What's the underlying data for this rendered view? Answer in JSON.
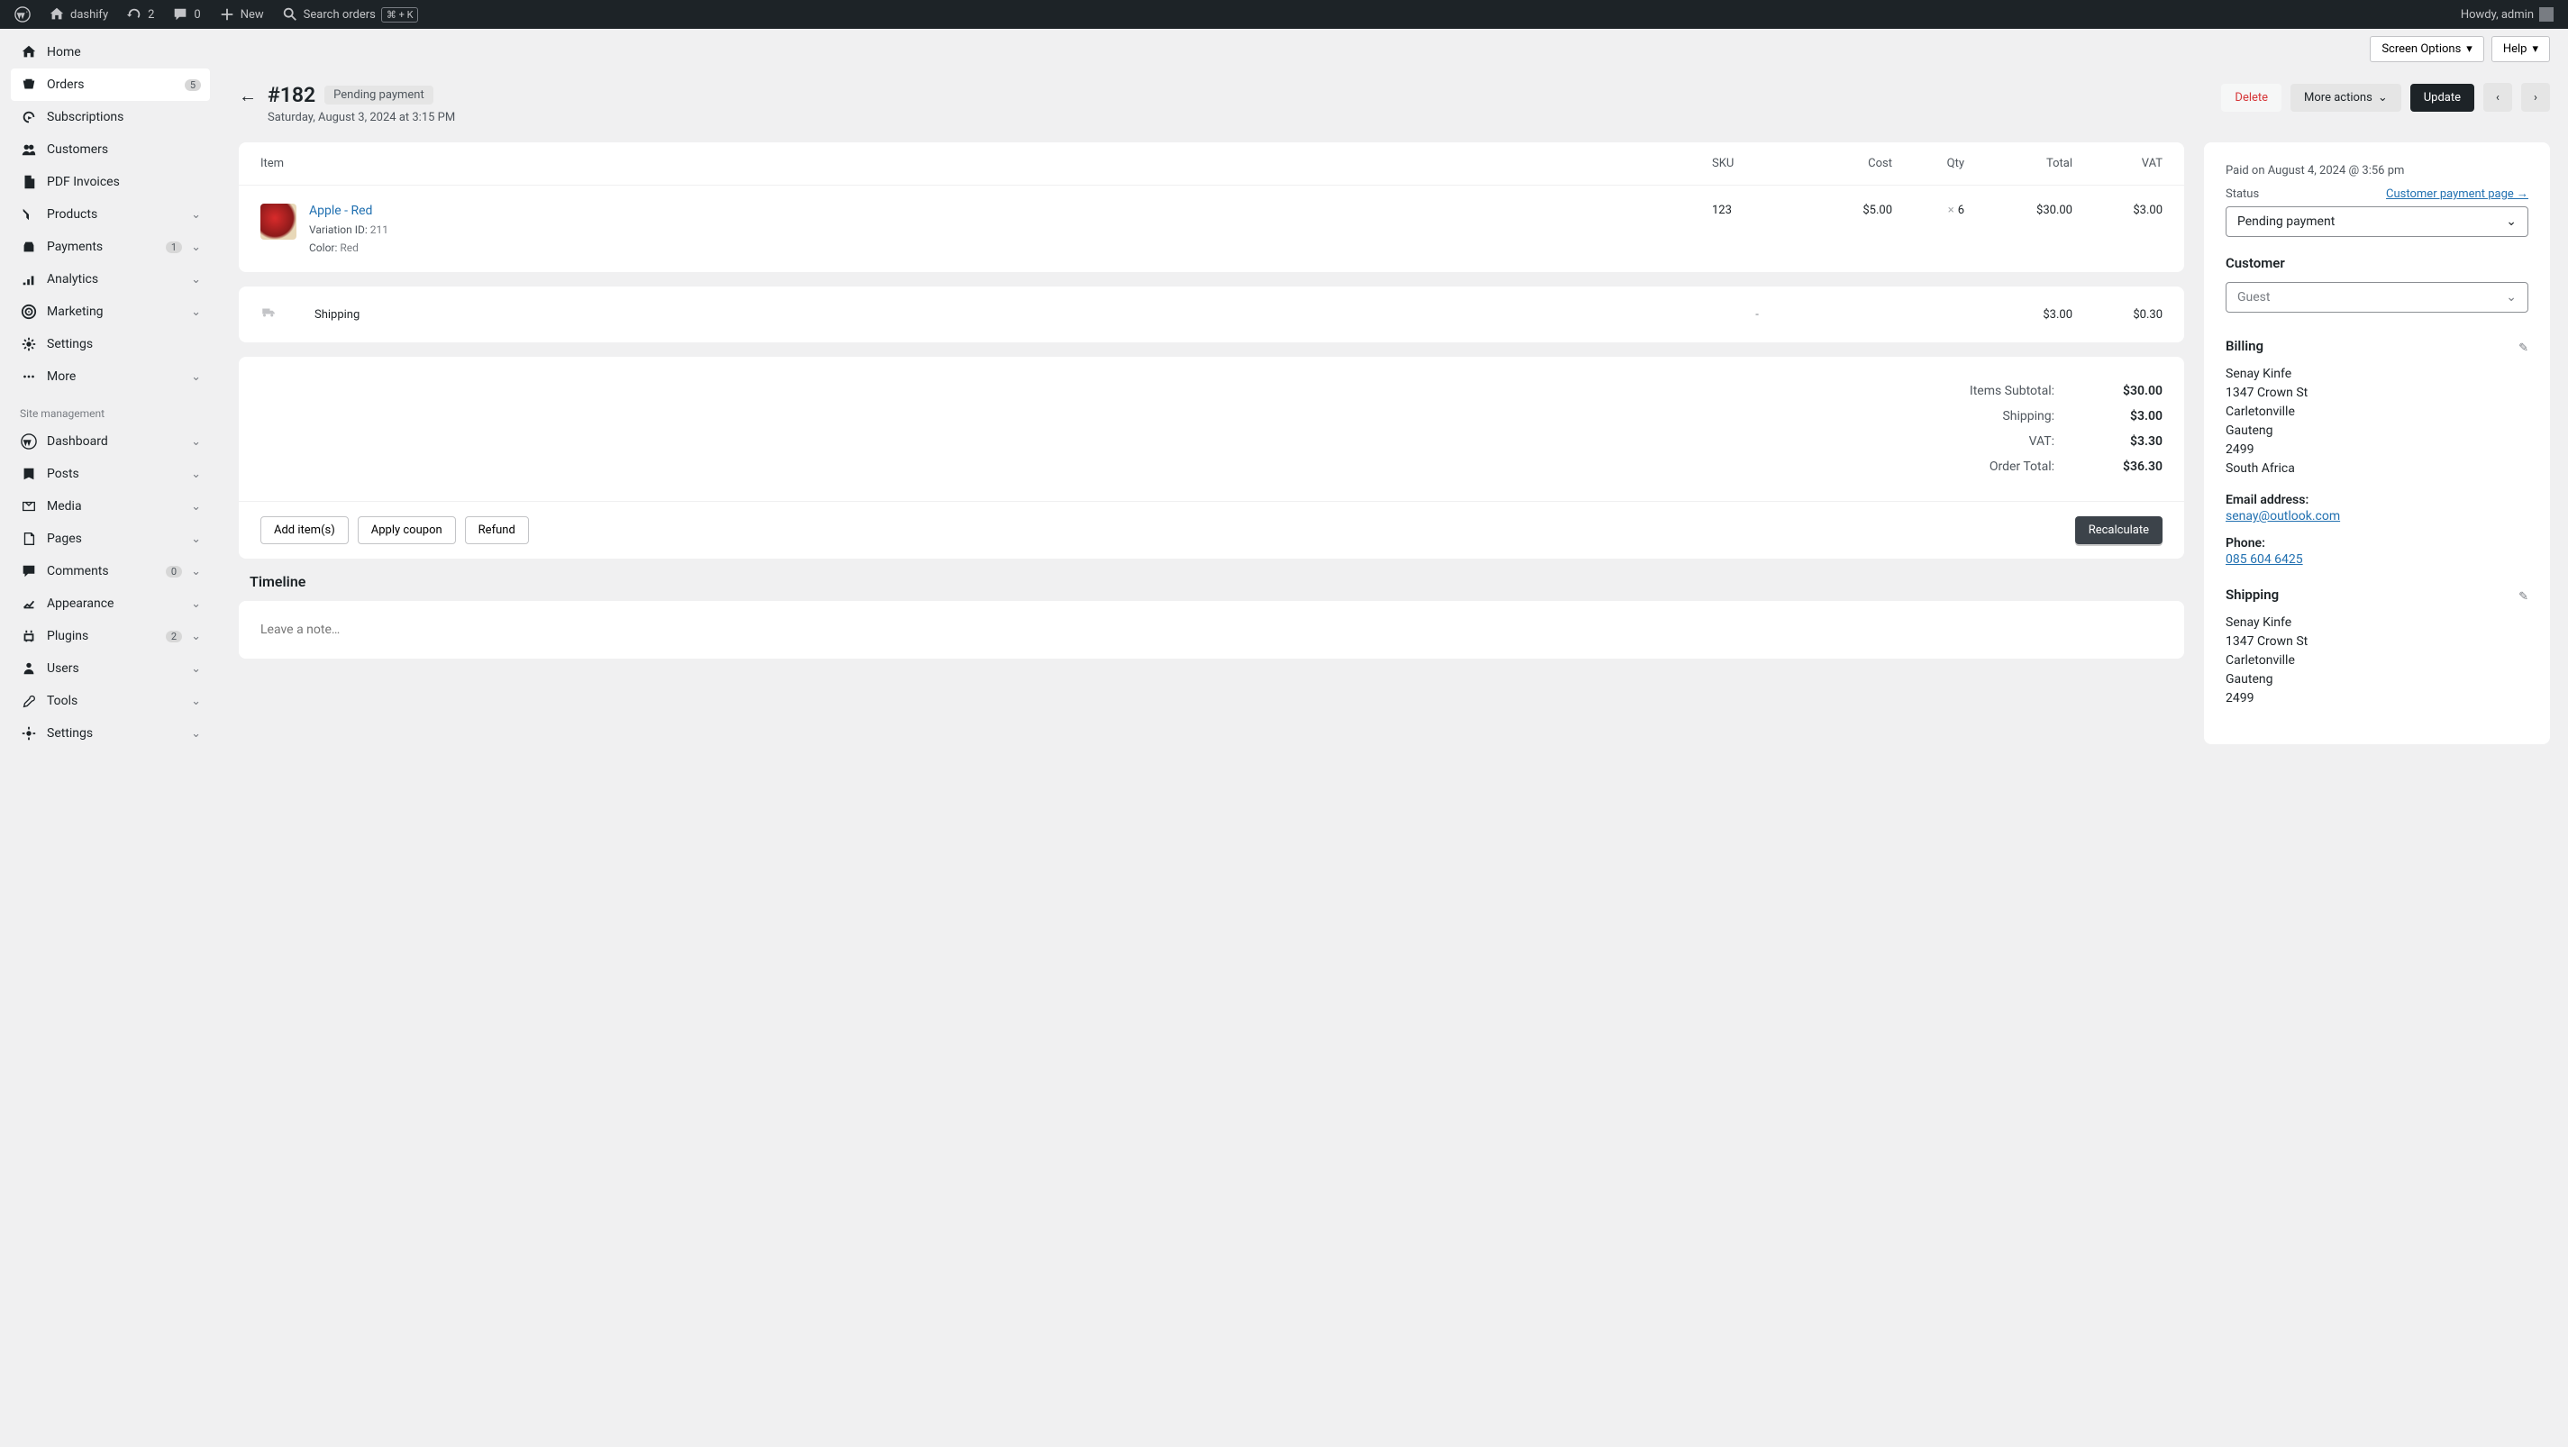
{
  "admin_bar": {
    "site_name": "dashify",
    "updates_count": "2",
    "comments_count": "0",
    "new_label": "New",
    "search_label": "Search orders",
    "search_kbd": "⌘ + K",
    "howdy": "Howdy, admin"
  },
  "top": {
    "screen_options": "Screen Options",
    "help": "Help"
  },
  "sidebar": {
    "items": [
      {
        "label": "Home"
      },
      {
        "label": "Orders",
        "badge": "5"
      },
      {
        "label": "Subscriptions"
      },
      {
        "label": "Customers"
      },
      {
        "label": "PDF Invoices"
      },
      {
        "label": "Products",
        "chevron": true
      },
      {
        "label": "Payments",
        "badge": "1",
        "chevron": true
      },
      {
        "label": "Analytics",
        "chevron": true
      },
      {
        "label": "Marketing",
        "chevron": true
      },
      {
        "label": "Settings"
      },
      {
        "label": "More",
        "chevron": true
      }
    ],
    "section_label": "Site management",
    "items2": [
      {
        "label": "Dashboard",
        "chevron": true
      },
      {
        "label": "Posts",
        "chevron": true
      },
      {
        "label": "Media",
        "chevron": true
      },
      {
        "label": "Pages",
        "chevron": true
      },
      {
        "label": "Comments",
        "badge": "0",
        "chevron": true
      },
      {
        "label": "Appearance",
        "chevron": true
      },
      {
        "label": "Plugins",
        "badge": "2",
        "chevron": true
      },
      {
        "label": "Users",
        "chevron": true
      },
      {
        "label": "Tools",
        "chevron": true
      },
      {
        "label": "Settings",
        "chevron": true
      }
    ]
  },
  "order": {
    "number": "#182",
    "status": "Pending payment",
    "date": "Saturday, August 3, 2024 at 3:15 PM"
  },
  "header_actions": {
    "delete": "Delete",
    "more": "More actions",
    "update": "Update"
  },
  "items_table": {
    "headers": {
      "item": "Item",
      "sku": "SKU",
      "cost": "Cost",
      "qty": "Qty",
      "total": "Total",
      "vat": "VAT"
    },
    "row": {
      "name": "Apple - Red",
      "variation_label": "Variation ID:",
      "variation_id": "211",
      "color_label": "Color:",
      "color": "Red",
      "sku": "123",
      "cost": "$5.00",
      "qty": "6",
      "total": "$30.00",
      "vat": "$3.00"
    },
    "shipping": {
      "label": "Shipping",
      "dash": "-",
      "total": "$3.00",
      "vat": "$0.30"
    }
  },
  "totals": {
    "subtotal_label": "Items Subtotal:",
    "subtotal": "$30.00",
    "shipping_label": "Shipping:",
    "shipping": "$3.00",
    "vat_label": "VAT:",
    "vat": "$3.30",
    "order_label": "Order Total:",
    "order": "$36.30"
  },
  "actions": {
    "add_items": "Add item(s)",
    "apply_coupon": "Apply coupon",
    "refund": "Refund",
    "recalculate": "Recalculate"
  },
  "timeline": {
    "title": "Timeline",
    "placeholder": "Leave a note…"
  },
  "side": {
    "paid": "Paid on August 4, 2024 @ 3:56 pm",
    "status_label": "Status",
    "payment_link": "Customer payment page →",
    "status_value": "Pending payment",
    "customer_h": "Customer",
    "customer_placeholder": "Guest",
    "billing_h": "Billing",
    "billing_addr": {
      "name": "Senay Kinfe",
      "street": "1347 Crown St",
      "city": "Carletonville",
      "region": "Gauteng",
      "postal": "2499",
      "country": "South Africa"
    },
    "email_label": "Email address:",
    "email": "senay@outlook.com",
    "phone_label": "Phone:",
    "phone": "085 604 6425",
    "shipping_h": "Shipping",
    "shipping_addr": {
      "name": "Senay Kinfe",
      "street": "1347 Crown St",
      "city": "Carletonville",
      "region": "Gauteng",
      "postal": "2499"
    }
  }
}
